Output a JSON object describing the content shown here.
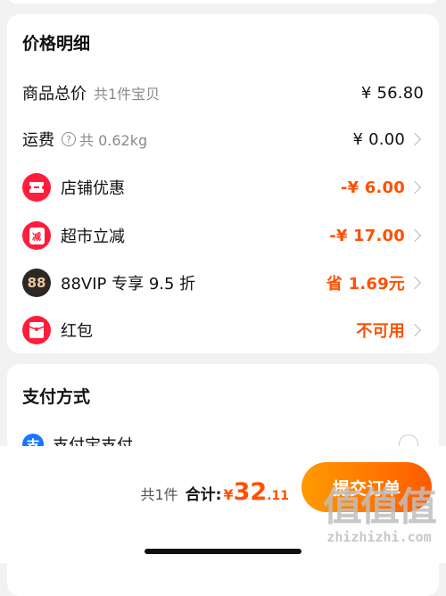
{
  "price_section": {
    "title": "价格明细",
    "total": {
      "label": "商品总价",
      "sub": "共1件宝贝",
      "value": "¥ 56.80"
    },
    "shipping": {
      "label": "运费",
      "help_glyph": "?",
      "sub": "共 0.62kg",
      "value": "¥ 0.00"
    },
    "store_discount": {
      "label": "店铺优惠",
      "value": "-¥ 6.00",
      "icon": "ticket-icon",
      "color": "#ff5000"
    },
    "supermarket_discount": {
      "label": "超市立减",
      "value": "-¥ 17.00",
      "icon": "reduce-icon",
      "glyph": "减"
    },
    "vip_discount": {
      "label": "88VIP 专享 9.5 折",
      "value": "省 1.69元",
      "icon": "88vip-icon",
      "glyph": "88"
    },
    "red_packet": {
      "label": "红包",
      "value": "不可用",
      "icon": "red-packet-icon"
    }
  },
  "payment_section": {
    "title": "支付方式",
    "method": {
      "label": "支付宝支付",
      "icon": "alipay-icon",
      "glyph": "支"
    }
  },
  "bottom_bar": {
    "count": "共1件",
    "total_label": "合计:",
    "currency": "¥",
    "total_int": "32",
    "total_dec": ".11",
    "submit_label": "提交订单"
  },
  "watermark": {
    "logo": "值值值",
    "domain": "zhizhizhi.com"
  },
  "colors": {
    "accent": "#ff5000",
    "icon_red": "#ff1d3b",
    "vip_dark": "#2e2825",
    "alipay_blue": "#1677ff"
  }
}
